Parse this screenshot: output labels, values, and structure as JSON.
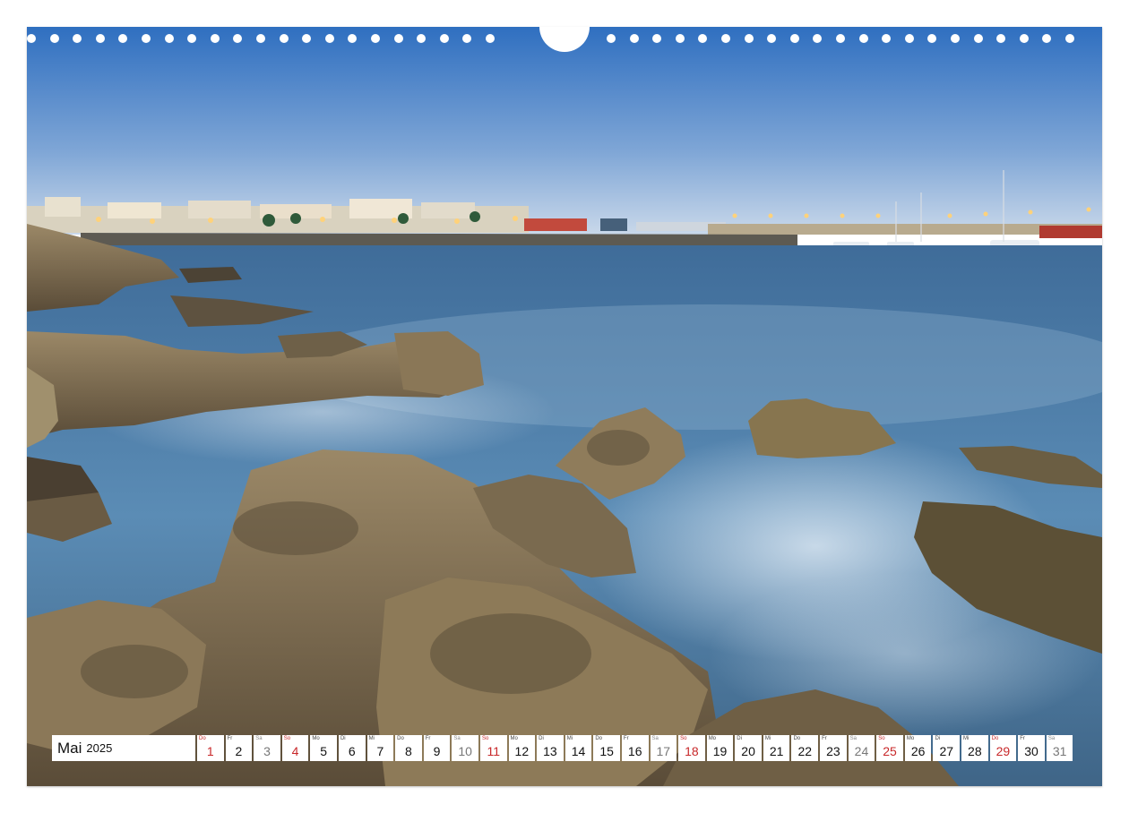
{
  "calendar": {
    "month": "Mai",
    "year": "2025",
    "days": [
      {
        "wd": "Do",
        "n": "1",
        "kind": "sun"
      },
      {
        "wd": "Fr",
        "n": "2",
        "kind": "weekday"
      },
      {
        "wd": "Sa",
        "n": "3",
        "kind": "sat"
      },
      {
        "wd": "So",
        "n": "4",
        "kind": "sun"
      },
      {
        "wd": "Mo",
        "n": "5",
        "kind": "weekday"
      },
      {
        "wd": "Di",
        "n": "6",
        "kind": "weekday"
      },
      {
        "wd": "Mi",
        "n": "7",
        "kind": "weekday"
      },
      {
        "wd": "Do",
        "n": "8",
        "kind": "weekday"
      },
      {
        "wd": "Fr",
        "n": "9",
        "kind": "weekday"
      },
      {
        "wd": "Sa",
        "n": "10",
        "kind": "sat"
      },
      {
        "wd": "So",
        "n": "11",
        "kind": "sun"
      },
      {
        "wd": "Mo",
        "n": "12",
        "kind": "weekday"
      },
      {
        "wd": "Di",
        "n": "13",
        "kind": "weekday"
      },
      {
        "wd": "Mi",
        "n": "14",
        "kind": "weekday"
      },
      {
        "wd": "Do",
        "n": "15",
        "kind": "weekday"
      },
      {
        "wd": "Fr",
        "n": "16",
        "kind": "weekday"
      },
      {
        "wd": "Sa",
        "n": "17",
        "kind": "sat"
      },
      {
        "wd": "So",
        "n": "18",
        "kind": "sun"
      },
      {
        "wd": "Mo",
        "n": "19",
        "kind": "weekday"
      },
      {
        "wd": "Di",
        "n": "20",
        "kind": "weekday"
      },
      {
        "wd": "Mi",
        "n": "21",
        "kind": "weekday"
      },
      {
        "wd": "Do",
        "n": "22",
        "kind": "weekday"
      },
      {
        "wd": "Fr",
        "n": "23",
        "kind": "weekday"
      },
      {
        "wd": "Sa",
        "n": "24",
        "kind": "sat"
      },
      {
        "wd": "So",
        "n": "25",
        "kind": "sun"
      },
      {
        "wd": "Mo",
        "n": "26",
        "kind": "weekday"
      },
      {
        "wd": "Di",
        "n": "27",
        "kind": "weekday"
      },
      {
        "wd": "Mi",
        "n": "28",
        "kind": "weekday"
      },
      {
        "wd": "Do",
        "n": "29",
        "kind": "sun"
      },
      {
        "wd": "Fr",
        "n": "30",
        "kind": "weekday"
      },
      {
        "wd": "Sa",
        "n": "31",
        "kind": "sat"
      }
    ]
  },
  "colors": {
    "sky_top": "#2f6fc0",
    "sky_horizon": "#c9d8ea",
    "sea": "#4d7fa8",
    "rock": "#7d6d52",
    "holiday_red": "#c8282a"
  }
}
